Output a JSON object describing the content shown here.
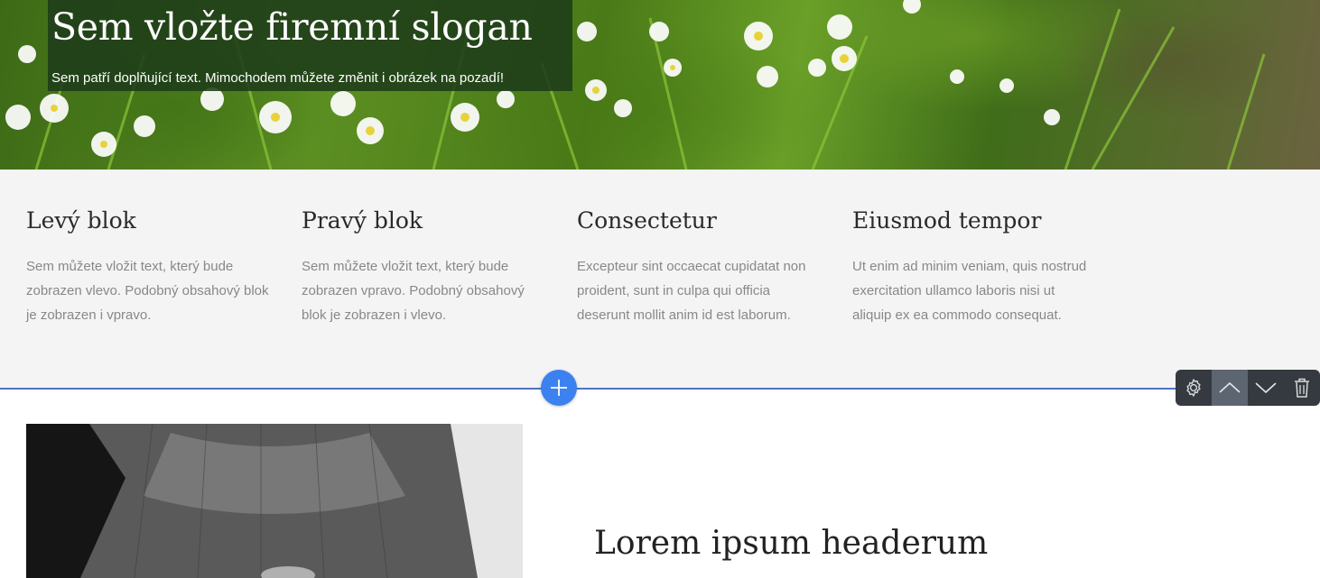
{
  "hero": {
    "slogan": "Sem vložte firemní slogan",
    "subtext": "Sem patří doplňující text. Mimochodem můžete změnit i obrázek na pozadí!"
  },
  "features": [
    {
      "title": "Levý blok",
      "text": "Sem můžete vložit text, který bude zobrazen vlevo. Podobný obsahový blok je zobrazen i vpravo."
    },
    {
      "title": "Pravý blok",
      "text": "Sem můžete vložit text, který bude zobrazen vpravo. Podobný obsahový blok je zobrazen i vlevo."
    },
    {
      "title": "Consectetur",
      "text": "Excepteur sint occaecat cupidatat non proident, sunt in culpa qui officia deserunt mollit anim id est laborum."
    },
    {
      "title": "Eiusmod tempor",
      "text": "Ut enim ad minim veniam, quis nostrud exercitation ullamco laboris nisi ut aliquip ex ea commodo consequat."
    }
  ],
  "editor": {
    "add_icon": "plus-icon",
    "toolbar_icons": [
      "gear-icon",
      "chevron-up-icon",
      "chevron-down-icon",
      "trash-icon"
    ],
    "accent_color": "#3b82f0",
    "divider_color": "#4e74c2"
  },
  "lower": {
    "title": "Lorem ipsum headerum"
  }
}
